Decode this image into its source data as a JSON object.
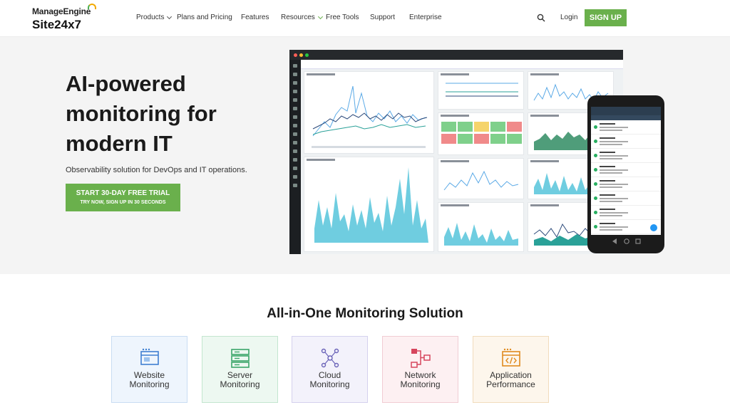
{
  "header": {
    "brand": "ManageEngine",
    "product": "Site24x7",
    "nav": [
      {
        "label": "Products",
        "dropdown": true
      },
      {
        "label": "Plans and Pricing",
        "dropdown": false
      },
      {
        "label": "Features",
        "dropdown": false
      },
      {
        "label": "Resources",
        "dropdown": true
      },
      {
        "label": "Free Tools",
        "dropdown": false
      },
      {
        "label": "Support",
        "dropdown": false
      },
      {
        "label": "Enterprise",
        "dropdown": false
      }
    ],
    "login": "Login",
    "signup": "SIGN UP"
  },
  "hero": {
    "title_lines": [
      "AI-powered",
      "monitoring for",
      "modern IT"
    ],
    "subtitle": "Observability solution for DevOps and IT operations.",
    "cta_primary": "START 30-DAY FREE TRIAL",
    "cta_secondary": "TRY NOW, SIGN UP IN 30 SECONDS"
  },
  "section": {
    "title": "All-in-One Monitoring Solution",
    "cards": [
      {
        "line1": "Website",
        "line2": "Monitoring",
        "icon": "website-icon",
        "bg": "#eef5fd",
        "border": "#c9ddf3",
        "accent": "#3f7fd1"
      },
      {
        "line1": "Server",
        "line2": "Monitoring",
        "icon": "server-icon",
        "bg": "#edf8f1",
        "border": "#c3e6cf",
        "accent": "#3aa66a"
      },
      {
        "line1": "Cloud",
        "line2": "Monitoring",
        "icon": "cloud-icon",
        "bg": "#f3f2fb",
        "border": "#d5d1ee",
        "accent": "#6a63b8"
      },
      {
        "line1": "Network",
        "line2": "Monitoring",
        "icon": "network-icon",
        "bg": "#fdf0f2",
        "border": "#f1ccd3",
        "accent": "#d6455d"
      },
      {
        "line1": "Application",
        "line2": "Performance",
        "icon": "application-icon",
        "bg": "#fdf6ec",
        "border": "#f1dcbc",
        "accent": "#e08a1e"
      }
    ]
  },
  "colors": {
    "brand_green": "#6ab04c",
    "hero_bg": "#f4f4f4"
  }
}
